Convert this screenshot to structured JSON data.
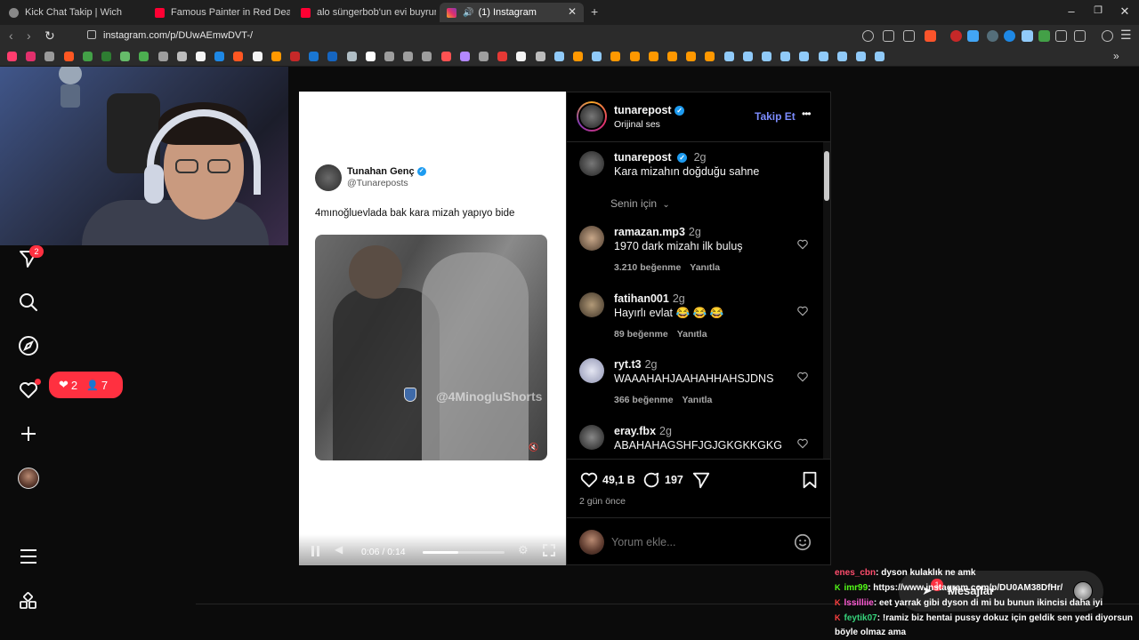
{
  "browser": {
    "tabs": [
      {
        "label": "Kick Chat Takip | Wich",
        "icon": "globe-icon",
        "color": "#888888"
      },
      {
        "label": "Famous Painter in Red Dead Redemp",
        "icon": "youtube-icon",
        "color": "#ff0033"
      },
      {
        "label": "alo süngerbob'un evi buyrun - YouTu",
        "icon": "youtube-icon",
        "color": "#ff0033"
      },
      {
        "label": "(1) Instagram",
        "icon": "instagram-icon",
        "color": "#e1306c"
      }
    ],
    "new_tab": "+",
    "url": "instagram.com/p/DUwAEmwDVT-/"
  },
  "instagram": {
    "nav_badge": "2",
    "notif_bubble": {
      "likes": "2",
      "follows": "7"
    },
    "tweet": {
      "name": "Tunahan Genç",
      "handle": "@Tunareposts",
      "text": "4mınoğluevlada bak kara mizah yapıyo bide",
      "watermark": "@4MinogluShorts"
    },
    "video": {
      "time": "0:06 / 0:14",
      "progress": 0.43
    },
    "header": {
      "username": "tunarepost",
      "subtitle": "Orijinal ses",
      "follow": "Takip Et",
      "more": "•••"
    },
    "caption": {
      "username": "tunarepost",
      "time": "2g",
      "text": "Kara mizahın doğduğu sahne"
    },
    "for_you": "Senin için",
    "comments": [
      {
        "user": "ramazan.mp3",
        "time": "2g",
        "text": "1970 dark mizahı ilk buluş",
        "likes": "3.210 beğenme",
        "reply": "Yanıtla",
        "color": "#6b5a4a"
      },
      {
        "user": "fatihan001",
        "time": "2g",
        "text": "Hayırlı evlat 😂 😂 😂",
        "likes": "89 beğenme",
        "reply": "Yanıtla",
        "color": "#7a6a55"
      },
      {
        "user": "ryt.t3",
        "time": "2g",
        "text": "WAAAHAHJAAHAHHAHSJDNS",
        "likes": "366 beğenme",
        "reply": "Yanıtla",
        "color": "#c8cbe0"
      },
      {
        "user": "eray.fbx",
        "time": "2g",
        "text": "ABAHAHAGSHFJGJGKGKKGKG",
        "likes": "",
        "reply": "",
        "color": "#3a3a3a"
      }
    ],
    "actions": {
      "likes": "49,1 B",
      "comments": "197"
    },
    "posted": "2 gün önce",
    "comment_placeholder": "Yorum ekle...",
    "messages": "Mesajlar",
    "messages_badge": "1"
  },
  "chat": [
    {
      "user": "enes_cbn",
      "badge": "",
      "user_color": "#ff4d6d",
      "text": ": dyson kulaklık ne amk"
    },
    {
      "user": "imr99",
      "badge": "K",
      "user_color": "#53fc18",
      "text": ": https://www.instagram.com/p/DU0AM38DfHr/"
    },
    {
      "user": "lssilliie",
      "badge": "K",
      "user_color": "#ff5cd6",
      "text": ": eet yarrak gibi dyson di mi bu bunun ikincisi daha iyi"
    },
    {
      "user": "feytik07",
      "badge": "K",
      "user_color": "#35d27a",
      "text": ": !ramiz biz hentai pussy dokuz için geldik sen yedi diyorsun"
    },
    {
      "user": "",
      "badge": "",
      "user_color": "#ffffff",
      "text": "böyle olmaz ama"
    }
  ]
}
